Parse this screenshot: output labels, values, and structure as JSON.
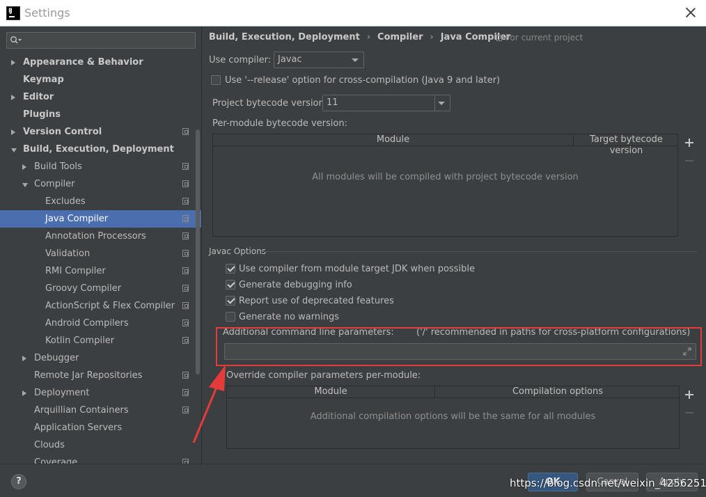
{
  "window": {
    "title": "Settings",
    "app_logo": "IJ"
  },
  "sidebar": {
    "search_placeholder": "",
    "items": [
      {
        "label": "Appearance & Behavior",
        "level": 0,
        "arrow": "right",
        "bold": true,
        "proj": false,
        "selected": false
      },
      {
        "label": "Keymap",
        "level": 0,
        "arrow": "",
        "bold": true,
        "proj": false,
        "selected": false
      },
      {
        "label": "Editor",
        "level": 0,
        "arrow": "right",
        "bold": true,
        "proj": false,
        "selected": false
      },
      {
        "label": "Plugins",
        "level": 0,
        "arrow": "",
        "bold": true,
        "proj": false,
        "selected": false
      },
      {
        "label": "Version Control",
        "level": 0,
        "arrow": "right",
        "bold": true,
        "proj": true,
        "selected": false
      },
      {
        "label": "Build, Execution, Deployment",
        "level": 0,
        "arrow": "down",
        "bold": true,
        "proj": false,
        "selected": false
      },
      {
        "label": "Build Tools",
        "level": 1,
        "arrow": "right",
        "bold": false,
        "proj": true,
        "selected": false
      },
      {
        "label": "Compiler",
        "level": 1,
        "arrow": "down",
        "bold": false,
        "proj": true,
        "selected": false
      },
      {
        "label": "Excludes",
        "level": 2,
        "arrow": "",
        "bold": false,
        "proj": true,
        "selected": false
      },
      {
        "label": "Java Compiler",
        "level": 2,
        "arrow": "",
        "bold": false,
        "proj": true,
        "selected": true
      },
      {
        "label": "Annotation Processors",
        "level": 2,
        "arrow": "",
        "bold": false,
        "proj": true,
        "selected": false
      },
      {
        "label": "Validation",
        "level": 2,
        "arrow": "",
        "bold": false,
        "proj": true,
        "selected": false
      },
      {
        "label": "RMI Compiler",
        "level": 2,
        "arrow": "",
        "bold": false,
        "proj": true,
        "selected": false
      },
      {
        "label": "Groovy Compiler",
        "level": 2,
        "arrow": "",
        "bold": false,
        "proj": true,
        "selected": false
      },
      {
        "label": "ActionScript & Flex Compiler",
        "level": 2,
        "arrow": "",
        "bold": false,
        "proj": true,
        "selected": false
      },
      {
        "label": "Android Compilers",
        "level": 2,
        "arrow": "",
        "bold": false,
        "proj": true,
        "selected": false
      },
      {
        "label": "Kotlin Compiler",
        "level": 2,
        "arrow": "",
        "bold": false,
        "proj": true,
        "selected": false
      },
      {
        "label": "Debugger",
        "level": 1,
        "arrow": "right",
        "bold": false,
        "proj": false,
        "selected": false
      },
      {
        "label": "Remote Jar Repositories",
        "level": 1,
        "arrow": "",
        "bold": false,
        "proj": true,
        "selected": false
      },
      {
        "label": "Deployment",
        "level": 1,
        "arrow": "right",
        "bold": false,
        "proj": true,
        "selected": false
      },
      {
        "label": "Arquillian Containers",
        "level": 1,
        "arrow": "",
        "bold": false,
        "proj": true,
        "selected": false
      },
      {
        "label": "Application Servers",
        "level": 1,
        "arrow": "",
        "bold": false,
        "proj": false,
        "selected": false
      },
      {
        "label": "Clouds",
        "level": 1,
        "arrow": "",
        "bold": false,
        "proj": false,
        "selected": false
      },
      {
        "label": "Coverage",
        "level": 1,
        "arrow": "",
        "bold": false,
        "proj": true,
        "selected": false
      }
    ]
  },
  "header": {
    "breadcrumb": [
      "Build, Execution, Deployment",
      "Compiler",
      "Java Compiler"
    ],
    "for_current_project": "For current project"
  },
  "form": {
    "use_compiler_label": "Use compiler:",
    "use_compiler_value": "Javac",
    "release_option_label": "Use '--release' option for cross-compilation (Java 9 and later)",
    "release_option_checked": false,
    "project_bytecode_label": "Project bytecode version:",
    "project_bytecode_value": "11",
    "per_module_label": "Per-module bytecode version:",
    "module_table": {
      "columns": [
        "Module",
        "Target bytecode version"
      ],
      "empty_text": "All modules will be compiled with project bytecode version"
    },
    "javac_options_title": "Javac Options",
    "options": [
      {
        "label": "Use compiler from module target JDK when possible",
        "checked": true
      },
      {
        "label": "Generate debugging info",
        "checked": true
      },
      {
        "label": "Report use of deprecated features",
        "checked": true
      },
      {
        "label": "Generate no warnings",
        "checked": false
      }
    ],
    "additional_params_label": "Additional command line parameters:",
    "additional_params_hint": "('/' recommended in paths for cross-platform configurations)",
    "additional_params_value": "",
    "override_label": "Override compiler parameters per-module:",
    "override_table": {
      "columns": [
        "Module",
        "Compilation options"
      ],
      "empty_text": "Additional compilation options will be the same for all modules"
    }
  },
  "footer": {
    "help": "?",
    "ok": "OK",
    "cancel": "Cancel",
    "apply": "Apply",
    "watermark": "https://blog.csdn.net/weixin_42562514"
  },
  "colors": {
    "selection": "#4b6eaf",
    "annotation": "#e63b3b",
    "ok_button": "#365880"
  },
  "icons": [
    "search-icon",
    "close-icon",
    "project-scope-icon",
    "plus-icon",
    "minus-icon",
    "expand-icon",
    "arrow-annotation-icon"
  ]
}
